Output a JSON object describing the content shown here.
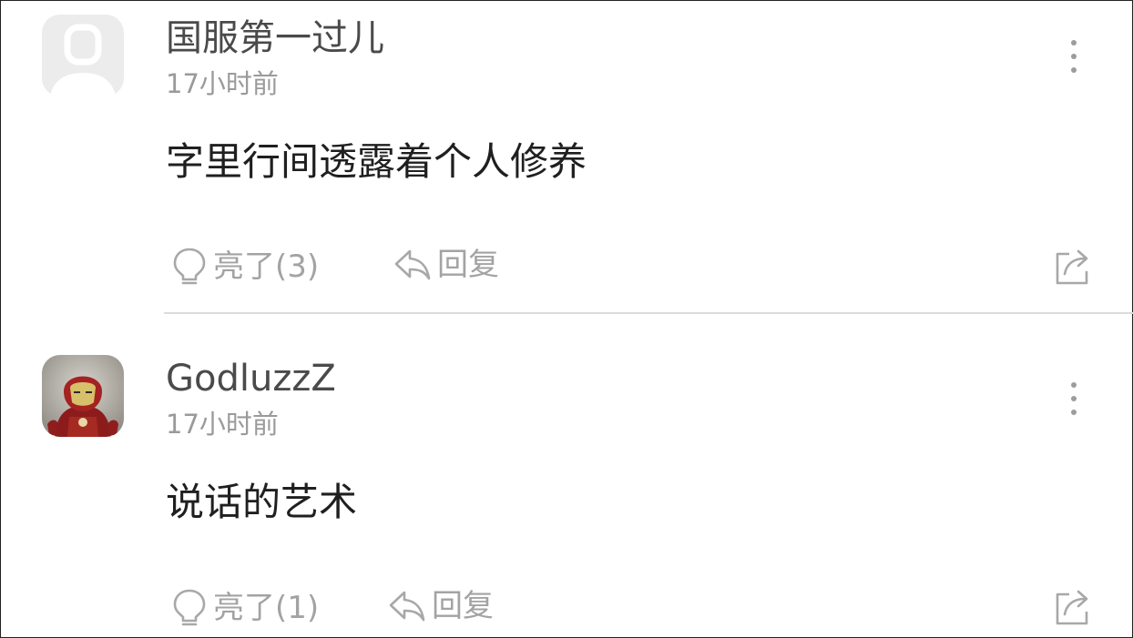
{
  "comments": [
    {
      "username": "国服第一过儿",
      "time": "17小时前",
      "content": "字里行间透露着个人修养",
      "like_label": "亮了(3)",
      "reply_label": "回复"
    },
    {
      "username": "GodluzzZ",
      "time": "17小时前",
      "content": "说话的艺术",
      "like_label": "亮了(1)",
      "reply_label": "回复"
    }
  ],
  "colors": {
    "username": "#4a4a4a",
    "secondary_text": "#9a9a9a",
    "content": "#1f1f1f",
    "divider": "#dcdcdc"
  },
  "icons": [
    "default-avatar-icon",
    "more-icon",
    "lightbulb-icon",
    "reply-icon",
    "share-icon"
  ]
}
